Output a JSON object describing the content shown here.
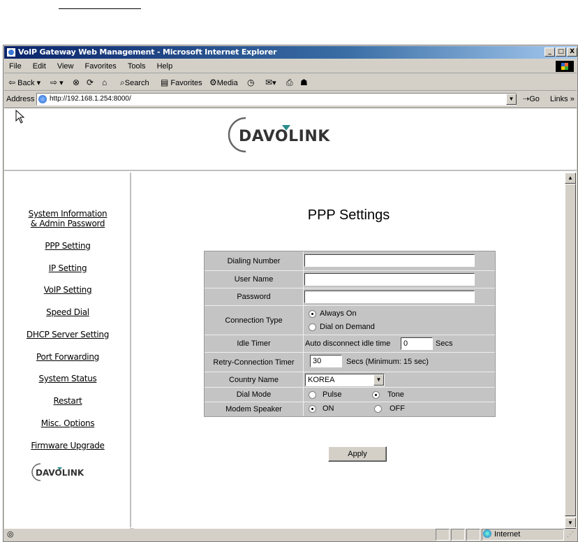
{
  "window": {
    "title": "VoIP Gateway Web Management - Microsoft Internet Explorer",
    "minimize": "_",
    "maximize": "□",
    "close": "X"
  },
  "menu": [
    "File",
    "Edit",
    "View",
    "Favorites",
    "Tools",
    "Help"
  ],
  "toolbar": {
    "back": "Back",
    "search": "Search",
    "favorites": "Favorites",
    "media": "Media"
  },
  "address": {
    "label": "Address",
    "url": "http://192.168.1.254:8000/",
    "go": "Go",
    "links": "Links"
  },
  "brand": {
    "logo_text": "DAVOLINK"
  },
  "nav": [
    "System Information",
    "& Admin Password",
    "PPP Setting",
    "IP Setting",
    "VoIP Setting",
    "Speed Dial",
    "DHCP Server Setting",
    "Port Forwarding",
    "System Status",
    "Restart",
    "Misc. Options",
    "Firmware Upgrade"
  ],
  "page": {
    "title": "PPP Settings"
  },
  "form": {
    "dialing_number": {
      "label": "Dialing Number",
      "value": ""
    },
    "user_name": {
      "label": "User Name",
      "value": ""
    },
    "password": {
      "label": "Password",
      "value": ""
    },
    "connection_type": {
      "label": "Connection Type",
      "options": [
        "Always On",
        "Dial on Demand"
      ],
      "selected": "Always On"
    },
    "idle_timer": {
      "label": "Idle Timer",
      "prefix": "Auto disconnect idle time",
      "value": "0",
      "unit": "Secs"
    },
    "retry_timer": {
      "label": "Retry-Connection Timer",
      "value": "30",
      "unit": "Secs  (Minimum: 15  sec)"
    },
    "country_name": {
      "label": "Country Name",
      "value": "KOREA"
    },
    "dial_mode": {
      "label": "Dial Mode",
      "options": [
        "Pulse",
        "Tone"
      ],
      "selected": "Tone"
    },
    "modem_speaker": {
      "label": "Modem Speaker",
      "options": [
        "ON",
        "OFF"
      ],
      "selected": "ON"
    },
    "apply_label": "Apply"
  },
  "status": {
    "zone": "Internet"
  }
}
